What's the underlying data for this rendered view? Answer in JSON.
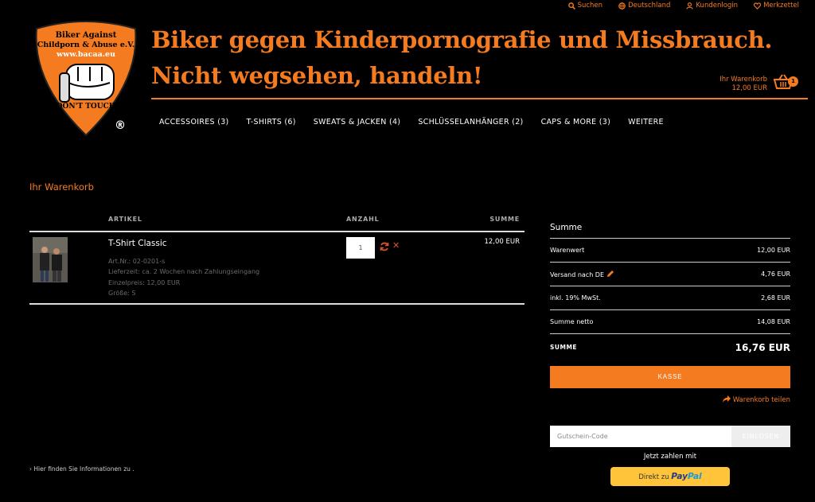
{
  "topbar": {
    "search": "Suchen",
    "country": "Deutschland",
    "login": "Kundenlogin",
    "wishlist": "Merkzettel"
  },
  "logo": {
    "line1": "Biker Against",
    "line2": "Childporn & Abuse e.V.",
    "url": "www.bacaa.eu",
    "slogan": "DON'T TOUCH",
    "reg": "®"
  },
  "headline": {
    "line1": "Biker gegen Kinderpornografie und Missbrauch.",
    "line2": "Nicht wegsehen, handeln!"
  },
  "minicart": {
    "label": "Ihr Warenkorb",
    "amount": "12,00 EUR",
    "count": "1"
  },
  "nav": [
    "ACCESSOIRES (3)",
    "T-SHIRTS (6)",
    "SWEATS & JACKEN (4)",
    "SCHLÜSSELANHÄNGER (2)",
    "CAPS & MORE (3)",
    "WEITERE"
  ],
  "cart": {
    "title": "Ihr Warenkorb",
    "headers": {
      "article": "ARTIKEL",
      "quantity": "ANZAHL",
      "sum": "SUMME"
    },
    "item": {
      "name": "T-Shirt Classic",
      "details": [
        "Art.Nr.: 02-0201-s",
        "Lieferzeit: ca. 2 Wochen nach Zahlungseingang",
        "Einzelpreis: 12,00 EUR",
        "Größe: S"
      ],
      "quantity": "1",
      "price": "12,00 EUR"
    }
  },
  "summary": {
    "title": "Summe",
    "rows": [
      {
        "label": "Warenwert",
        "value": "12,00 EUR"
      },
      {
        "label": "Versand nach DE",
        "value": "4,76 EUR"
      },
      {
        "label": "inkl. 19% MwSt.",
        "value": "2,68 EUR"
      },
      {
        "label": "Summe netto",
        "value": "14,08 EUR"
      }
    ],
    "total_label": "SUMME",
    "total_value": "16,76 EUR",
    "checkout": "KASSE",
    "share": "Warenkorb teilen"
  },
  "voucher": {
    "placeholder": "Gutschein-Code",
    "button": "EINLÖSEN"
  },
  "paynow": {
    "label": "Jetzt zahlen mit",
    "button_prefix": "Direkt zu",
    "pay": "Pay",
    "pal": "Pal"
  },
  "info": "Hier finden Sie Informationen zu ."
}
